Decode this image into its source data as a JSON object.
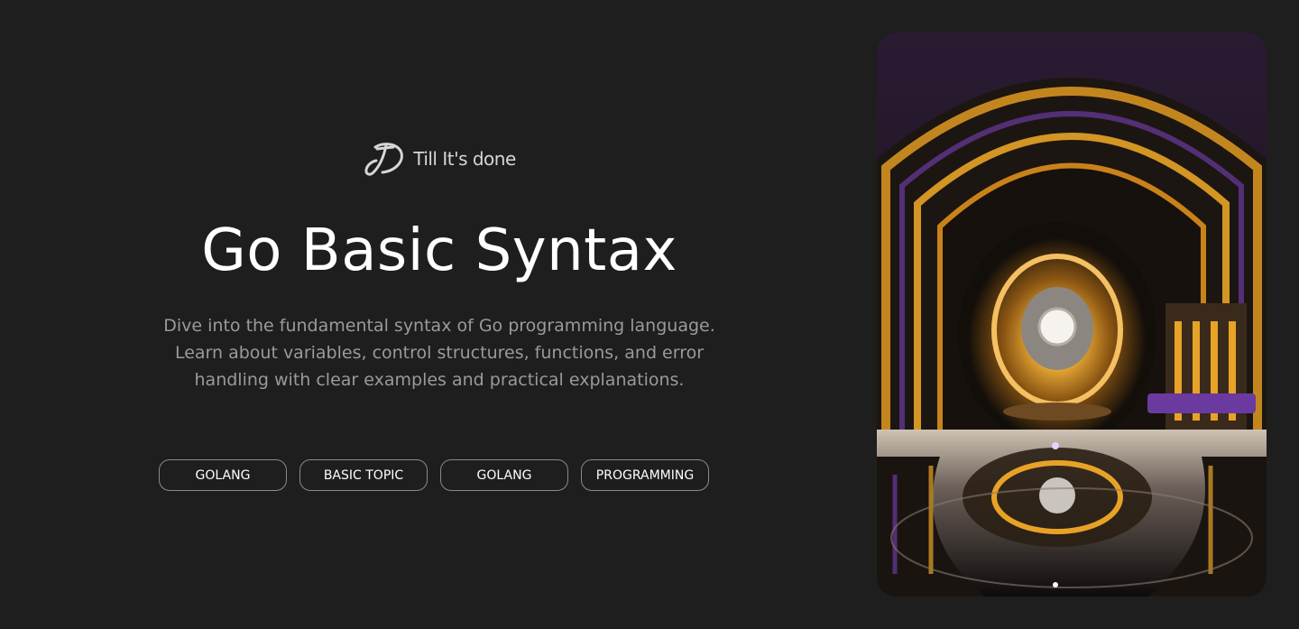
{
  "brand": {
    "logo_icon": "td-monogram-icon",
    "name": "Till It's done"
  },
  "hero": {
    "title": "Go Basic Syntax",
    "description": "Dive into the fundamental syntax of Go programming language. Learn about variables, control structures, functions, and error handling with clear examples and practical explanations."
  },
  "tags": [
    {
      "label": "GOLANG"
    },
    {
      "label": "BASIC TOPIC"
    },
    {
      "label": "GOLANG"
    },
    {
      "label": "PROGRAMMING"
    }
  ],
  "image": {
    "subject": "futuristic-arched-hall",
    "colors": {
      "gold": "#e8a326",
      "purple": "#6b3aa0",
      "dark": "#141210"
    }
  },
  "colors": {
    "background": "#1e1e1e",
    "title": "#ffffff",
    "description": "#9a9a9a",
    "tag_border": "#8a8a8a"
  }
}
